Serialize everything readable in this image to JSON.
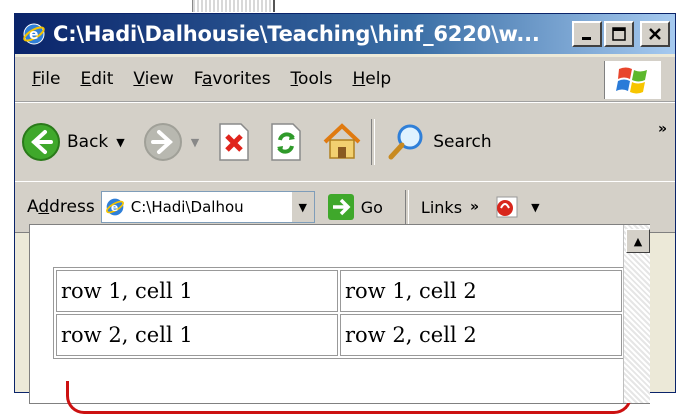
{
  "window": {
    "title": "C:\\Hadi\\Dalhousie\\Teaching\\hinf_6220\\w..."
  },
  "menu": {
    "items": [
      {
        "label": "File",
        "accel": "F"
      },
      {
        "label": "Edit",
        "accel": "E"
      },
      {
        "label": "View",
        "accel": "V"
      },
      {
        "label": "Favorites",
        "accel": "a"
      },
      {
        "label": "Tools",
        "accel": "T"
      },
      {
        "label": "Help",
        "accel": "H"
      }
    ]
  },
  "toolbar": {
    "back_label": "Back",
    "search_label": "Search",
    "more": "»"
  },
  "address": {
    "label": "Address",
    "value": "C:\\Hadi\\Dalhou",
    "go_label": "Go",
    "links_label": "Links",
    "links_more": "»"
  },
  "table": {
    "rows": [
      [
        "row 1, cell 1",
        "row 1, cell 2"
      ],
      [
        "row 2, cell 1",
        "row 2, cell 2"
      ]
    ]
  },
  "colors": {
    "titlebar": "#0a246a",
    "chrome": "#d4d0c8",
    "annotation": "#cc1111"
  }
}
